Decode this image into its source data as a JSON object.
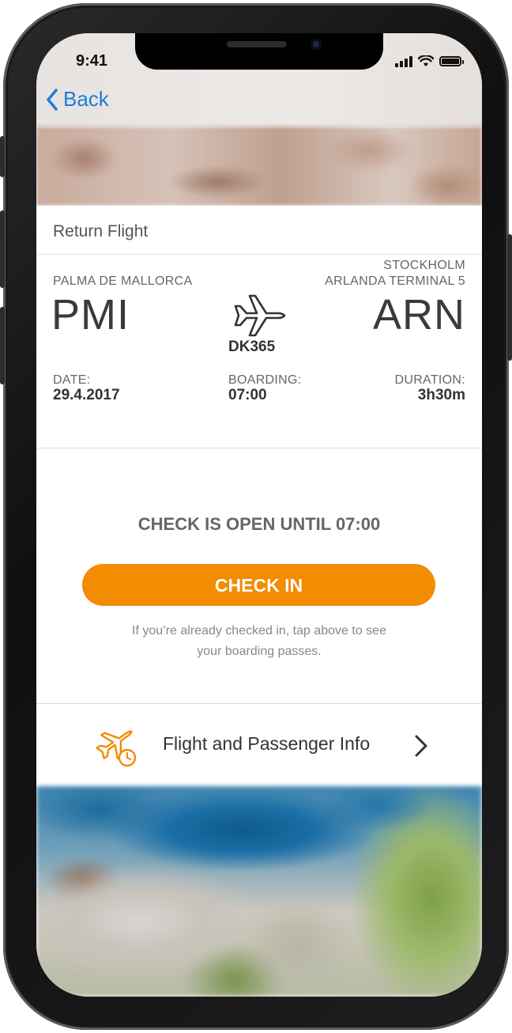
{
  "status_bar": {
    "time": "9:41"
  },
  "nav": {
    "back_label": "Back"
  },
  "section": {
    "title": "Return Flight"
  },
  "flight": {
    "origin_city": "PALMA DE MALLORCA",
    "origin_code": "PMI",
    "destination_city_line1": "STOCKHOLM",
    "destination_city_line2": "ARLANDA TERMINAL 5",
    "destination_code": "ARN",
    "flight_number": "DK365",
    "date_label": "DATE:",
    "date_value": "29.4.2017",
    "boarding_label": "BOARDING:",
    "boarding_value": "07:00",
    "duration_label": "DURATION:",
    "duration_value": "3h30m"
  },
  "checkin": {
    "status_text": "CHECK IS OPEN UNTIL 07:00",
    "button_label": "CHECK IN",
    "hint_line1": "If you’re already checked in, tap above to see",
    "hint_line2": "your boarding passes."
  },
  "info_row": {
    "label": "Flight and Passenger Info"
  },
  "colors": {
    "accent": "#f28c00",
    "link": "#1a7fd9",
    "text_primary": "#333333",
    "text_secondary": "#666666"
  },
  "icons": [
    "chevron-left-icon",
    "signal-icon",
    "wifi-icon",
    "battery-icon",
    "airplane-icon",
    "plane-clock-icon",
    "chevron-right-icon"
  ]
}
